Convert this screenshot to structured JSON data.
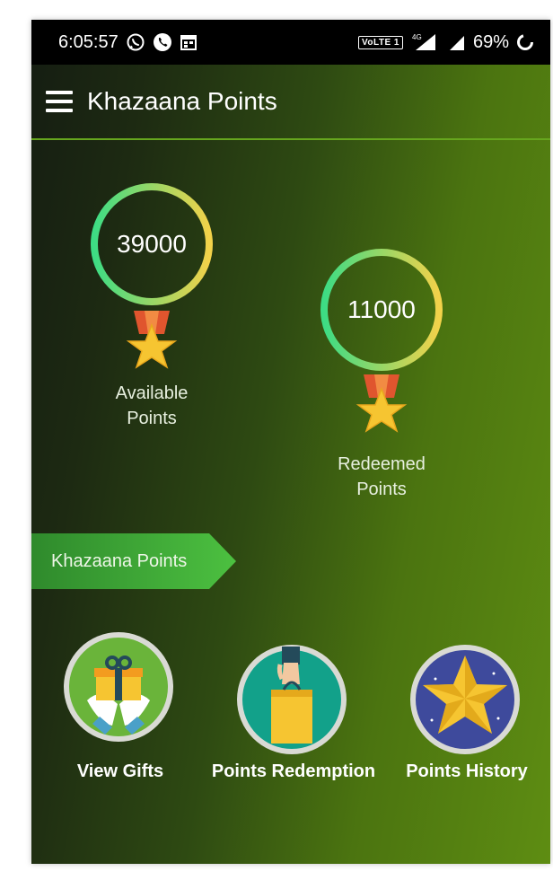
{
  "status_bar": {
    "time": "6:05:57",
    "icons_left": [
      "whatsapp-icon",
      "phone-icon",
      "calendar-icon"
    ],
    "volte": "VoLTE 1",
    "network": "4G",
    "battery": "69%"
  },
  "app_bar": {
    "title": "Khazaana Points",
    "menu_icon": "hamburger-menu-icon"
  },
  "points": {
    "available": {
      "value": "39000",
      "label_line1": "Available",
      "label_line2": "Points"
    },
    "redeemed": {
      "value": "11000",
      "label_line1": "Redeemed",
      "label_line2": "Points"
    }
  },
  "section_banner": {
    "label": "Khazaana Points"
  },
  "actions": [
    {
      "label": "View Gifts",
      "icon": "gift-icon"
    },
    {
      "label": "Points Redemption",
      "icon": "shopping-bag-icon"
    },
    {
      "label": "Points History",
      "icon": "star-icon"
    }
  ],
  "colors": {
    "ring_start": "#3ddc84",
    "ring_end": "#f2d24a",
    "banner": "#3fae3a",
    "accent_line": "#66a61e"
  }
}
